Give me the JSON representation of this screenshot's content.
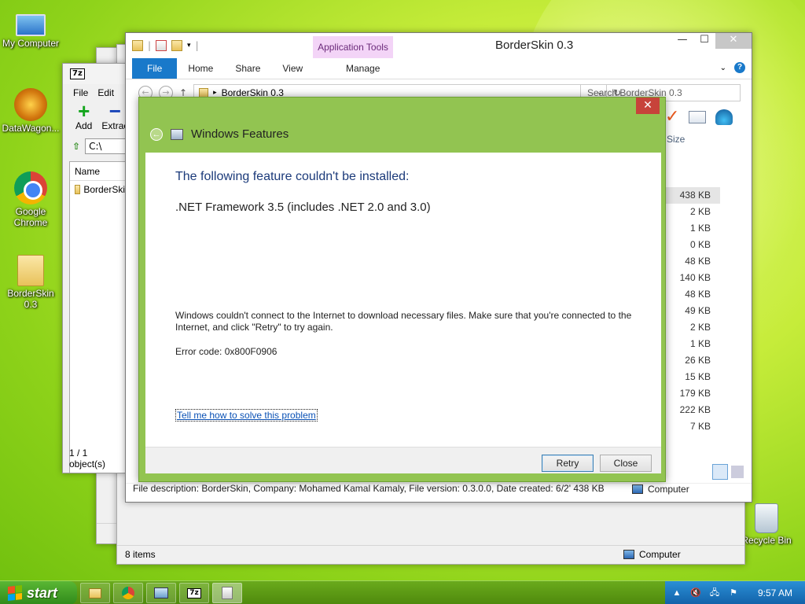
{
  "desktop": {
    "icons": [
      {
        "label": "My Computer",
        "icon": "computer-icon"
      },
      {
        "label": "DataWagon...",
        "icon": "star-icon"
      },
      {
        "label": "Google Chrome",
        "icon": "chrome-icon"
      },
      {
        "label": "BorderSkin 0.3",
        "icon": "folder-icon"
      },
      {
        "label": "Recycle Bin",
        "icon": "recycle-bin-icon"
      }
    ]
  },
  "sevenzip": {
    "logo": "7z",
    "menu": [
      "File",
      "Edit"
    ],
    "toolbar": {
      "add": "Add",
      "extract": "Extrac"
    },
    "path": "C:\\",
    "column_name": "Name",
    "row": "BorderSki",
    "status": "1 / 1 object(s)"
  },
  "explorer": {
    "title": "BorderSkin 0.3",
    "context_tab": "Application Tools",
    "tabs": {
      "file": "File",
      "home": "Home",
      "share": "Share",
      "view": "View",
      "manage": "Manage"
    },
    "address": "BorderSkin 0.3",
    "search_placeholder": "Search BorderSkin 0.3",
    "size_header": "Size",
    "sizes": [
      "438 KB",
      "2 KB",
      "1 KB",
      "0 KB",
      "48 KB",
      "140 KB",
      "48 KB",
      "49 KB",
      "2 KB",
      "1 KB",
      "26 KB",
      "15 KB",
      "179 KB",
      "222 KB",
      "7 KB"
    ],
    "file_description": "File description: BorderSkin, Company: Mohamed Kamal Kamaly, File version: 0.3.0.0, Date created: 6/2'   438 KB",
    "status_computer": "Computer",
    "items_count": "8 items"
  },
  "dialog": {
    "title": "Windows Features",
    "heading": "The following feature couldn't be installed:",
    "feature": ".NET Framework 3.5 (includes .NET 2.0 and 3.0)",
    "message": "Windows couldn't connect to the Internet to download necessary files. Make sure that you're connected to the Internet, and click \"Retry\" to try again.",
    "error_code": "Error code: 0x800F0906",
    "help_link": "Tell me how to solve this problem",
    "retry": "Retry",
    "close": "Close"
  },
  "taskbar": {
    "start": "start",
    "clock": "9:57 AM"
  }
}
